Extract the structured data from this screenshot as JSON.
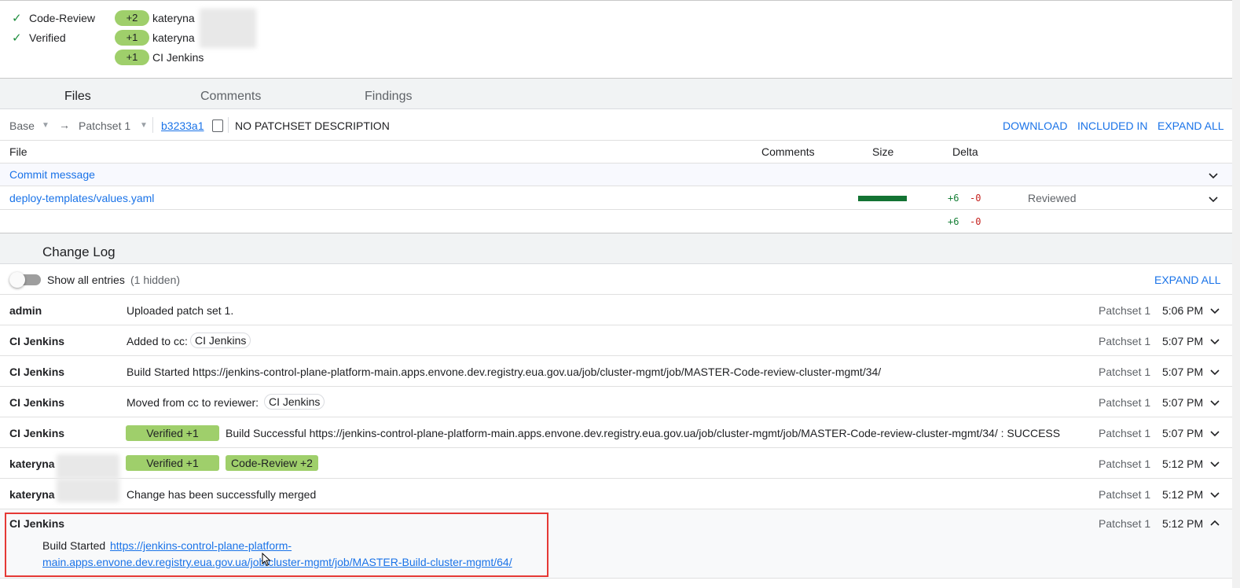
{
  "labels": [
    {
      "name": "Code-Review"
    },
    {
      "name": "Verified"
    }
  ],
  "votes": [
    {
      "value": "+2",
      "user": "kateryna"
    },
    {
      "value": "+1",
      "user": "kateryna"
    },
    {
      "value": "+1",
      "user": "CI Jenkins"
    }
  ],
  "tabs": [
    "Files",
    "Comments",
    "Findings"
  ],
  "files_toolbar": {
    "base": "Base",
    "arrow": "→",
    "patchset": "Patchset 1",
    "commit": "b3233a1",
    "description": "NO PATCHSET DESCRIPTION",
    "download": "DOWNLOAD",
    "included_in": "INCLUDED IN",
    "expand_all": "EXPAND ALL"
  },
  "files_table": {
    "headers": {
      "file": "File",
      "comments": "Comments",
      "size": "Size",
      "delta": "Delta"
    },
    "commit_message": "Commit message",
    "file": {
      "path": "deploy-templates/values.yaml",
      "added": "+6",
      "removed": "-0",
      "status": "Reviewed"
    },
    "total": {
      "added": "+6",
      "removed": "-0"
    }
  },
  "changelog": {
    "title": "Change Log",
    "show_all": "Show all entries",
    "hidden": "(1 hidden)",
    "expand_all": "EXPAND ALL",
    "entries": [
      {
        "author": "admin",
        "message": "Uploaded patch set 1.",
        "patchset": "Patchset 1",
        "time": "5:06 PM"
      },
      {
        "author": "CI Jenkins",
        "message": "Added to cc:",
        "chip": "CI Jenkins",
        "patchset": "Patchset 1",
        "time": "5:07 PM"
      },
      {
        "author": "CI Jenkins",
        "message": "Build Started https://jenkins-control-plane-platform-main.apps.envone.dev.registry.eua.gov.ua/job/cluster-mgmt/job/MASTER-Code-review-cluster-mgmt/34/",
        "patchset": "Patchset 1",
        "time": "5:07 PM"
      },
      {
        "author": "CI Jenkins",
        "message": "Moved from cc to reviewer:",
        "chip": "CI Jenkins",
        "patchset": "Patchset 1",
        "time": "5:07 PM"
      },
      {
        "author": "CI Jenkins",
        "badge": "Verified +1",
        "message": "Build Successful https://jenkins-control-plane-platform-main.apps.envone.dev.registry.eua.gov.ua/job/cluster-mgmt/job/MASTER-Code-review-cluster-mgmt/34/ : SUCCESS",
        "patchset": "Patchset 1",
        "time": "5:07 PM"
      },
      {
        "author": "kateryna",
        "badge": "Verified +1",
        "badge2": "Code-Review +2",
        "patchset": "Patchset 1",
        "time": "5:12 PM"
      },
      {
        "author": "kateryna",
        "message": "Change has been successfully merged",
        "patchset": "Patchset 1",
        "time": "5:12 PM"
      },
      {
        "author": "CI Jenkins",
        "patchset": "Patchset 1",
        "time": "5:12 PM",
        "expanded_prefix": "Build Started",
        "expanded_link_line1": "https://jenkins-control-plane-platform-",
        "expanded_link_line2": "main.apps.envone.dev.registry.eua.gov.ua/job/cluster-mgmt/job/MASTER-Build-cluster-mgmt/64/"
      }
    ]
  },
  "colors": {
    "accent": "#1a73e8",
    "vote_green": "#9fcf6b",
    "check_green": "#1e8e3e",
    "size_bar": "#137333",
    "highlight_border": "#e53935"
  }
}
